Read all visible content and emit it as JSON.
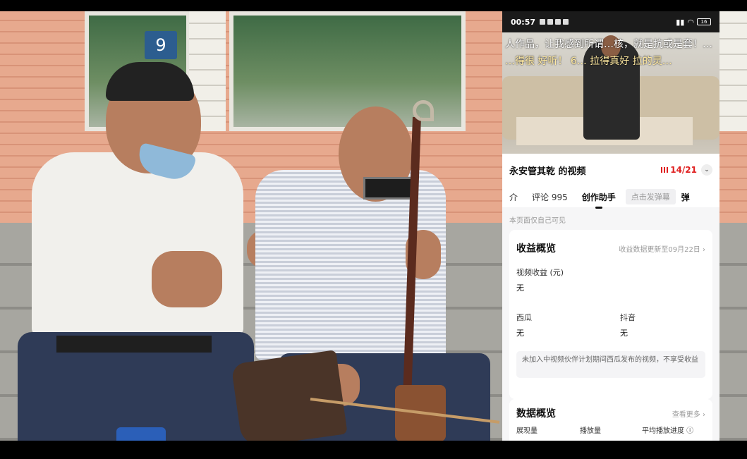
{
  "phone": {
    "status": {
      "time": "00:57",
      "battery": "16"
    },
    "video": {
      "danmu_line1": "人作品，让我感到所谓…核，就是抗或是套！…",
      "danmu_line2": "…得很 好听！  6…  拉得真好   拉的灵…"
    },
    "title": "永安管其乾 的视频",
    "counter": "14/21",
    "tabs": [
      {
        "label": "介"
      },
      {
        "label": "评论 995"
      },
      {
        "label": "创作助手"
      }
    ],
    "danmu_placeholder": "点击发弹幕",
    "danmu_icon": "弹",
    "note": "本页面仅自己可见",
    "income": {
      "title": "收益概览",
      "update": "收益数据更新至09月22日 ›",
      "video_income_label": "视频收益 (元)",
      "video_income_value": "无",
      "xigua_label": "西瓜",
      "xigua_value": "无",
      "douyin_label": "抖音",
      "douyin_value": "无",
      "tip": "未加入中视频伙伴计划期间西瓜发布的视频，不享受收益"
    },
    "data": {
      "title": "数据概览",
      "more": "查看更多 ›",
      "col1": "展现量",
      "col2": "播放量",
      "col3": "平均播放进度 ⓘ"
    }
  },
  "scene": {
    "sign": "9"
  }
}
